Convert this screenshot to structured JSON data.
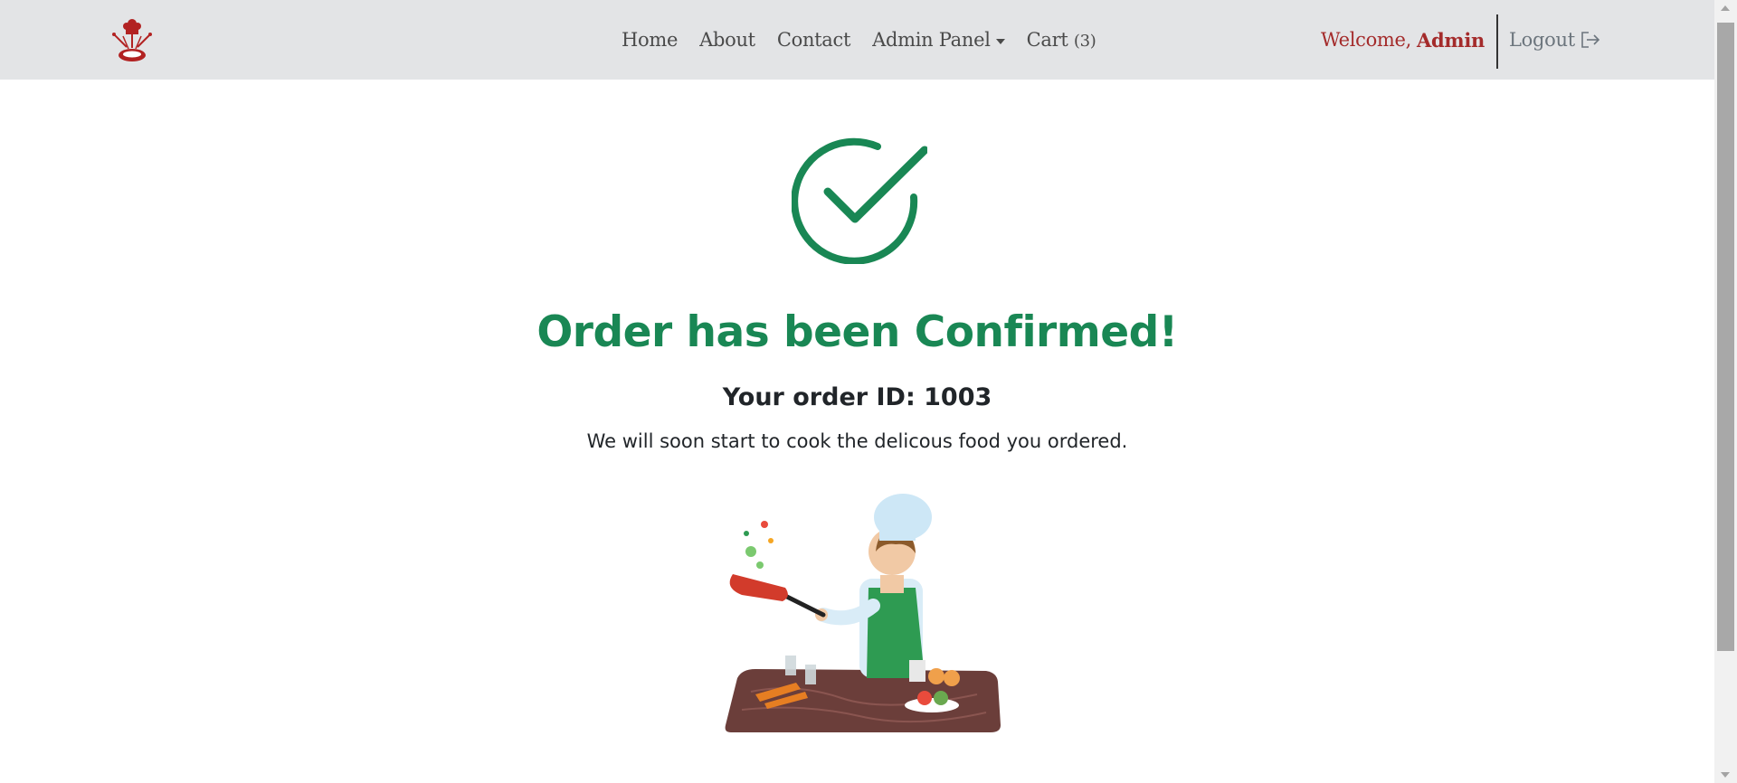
{
  "navbar": {
    "logo_icon": "chef-hat-logo-icon",
    "links": [
      {
        "label": "Home"
      },
      {
        "label": "About"
      },
      {
        "label": "Contact"
      },
      {
        "label": "Admin Panel"
      },
      {
        "label": "Cart",
        "count": "(3)"
      }
    ],
    "welcome_text": "Welcome,",
    "username": "Admin",
    "logout_label": "Logout",
    "logout_icon": "logout-icon"
  },
  "confirmation": {
    "icon": "check-circle-icon",
    "title": "Order has been Confirmed!",
    "order_id_label": "Your order ID: 1003",
    "message": "We will soon start to cook the delicous food you ordered.",
    "illustration": "chef-cooking-illustration"
  },
  "colors": {
    "success": "#198754",
    "brand": "#a42b2b",
    "navbar_bg": "#e3e4e6"
  }
}
